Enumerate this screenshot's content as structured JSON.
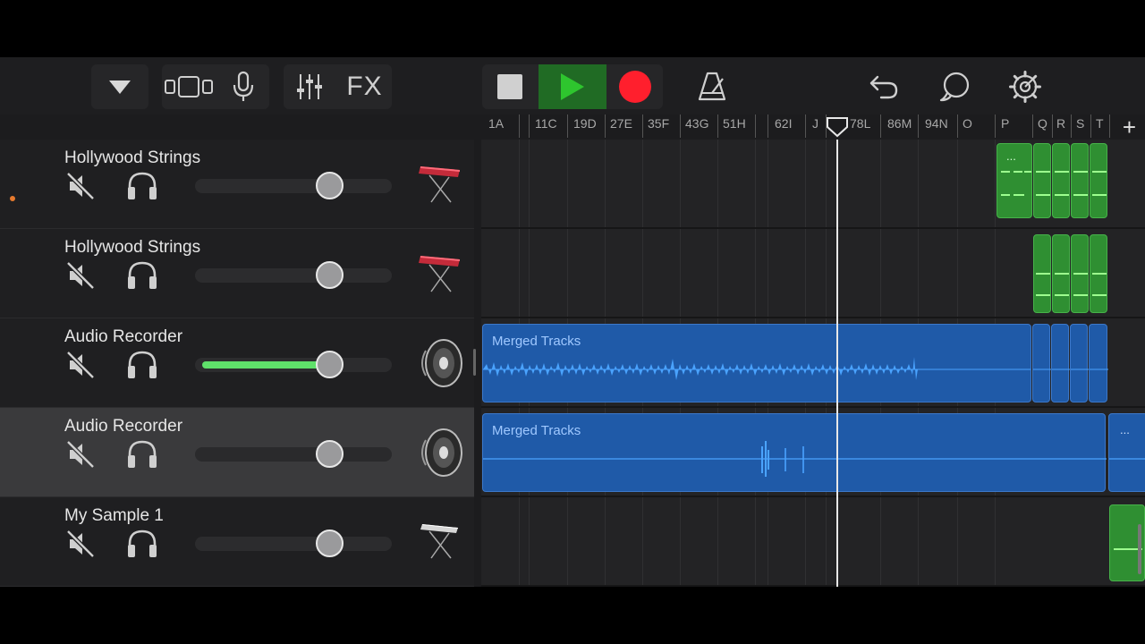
{
  "toolbar": {
    "fx_label": "FX"
  },
  "ruler": {
    "labels": [
      "1A",
      "11C",
      "19D",
      "27E",
      "35F",
      "43G",
      "51H",
      "62I",
      "J",
      "78L",
      "86M",
      "94N",
      "O",
      "P",
      "Q",
      "R",
      "S",
      "T"
    ],
    "add_label": "+"
  },
  "tracks": [
    {
      "name": "Hollywood Strings",
      "volume": 0.68,
      "selected": false,
      "instrument": "keyboard-stand-red",
      "recording_marker": true
    },
    {
      "name": "Hollywood Strings",
      "volume": 0.68,
      "selected": false,
      "instrument": "keyboard-stand-red",
      "recording_marker": false
    },
    {
      "name": "Audio Recorder",
      "volume": 0.68,
      "level": 0.68,
      "selected": false,
      "instrument": "speaker",
      "recording_marker": false
    },
    {
      "name": "Audio Recorder",
      "volume": 0.68,
      "selected": true,
      "instrument": "speaker",
      "recording_marker": false
    },
    {
      "name": "My Sample 1",
      "volume": 0.68,
      "selected": false,
      "instrument": "keyboard-stand-white",
      "recording_marker": false
    }
  ],
  "regions": {
    "track3_label": "Merged Tracks",
    "track4_label": "Merged Tracks",
    "more": "..."
  },
  "colors": {
    "record": "#ff1f2d",
    "play": "#2ec52e",
    "audio_region": "#1f5aa8",
    "midi_region": "#2f8f32",
    "level_meter": "#5fe06a"
  }
}
